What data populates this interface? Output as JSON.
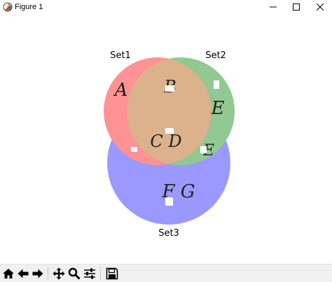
{
  "window": {
    "title": "Figure 1",
    "icons": {
      "app": "matplotlib-icon",
      "minimize": "minimize-icon",
      "maximize": "maximize-icon",
      "close": "close-icon"
    }
  },
  "venn": {
    "set_labels": [
      "Set1",
      "Set2",
      "Set3"
    ],
    "region_labels": {
      "set1_only": "A",
      "set1_set2": "B",
      "set2_only": "E",
      "center": "C D",
      "set2_set3": "E",
      "set3_only": "F G"
    },
    "colors": {
      "set1": "#ff8080",
      "set2": "#80c080",
      "set3": "#8080ff",
      "set1_set2": "#d8b890",
      "set1_set2_set3": "#c0a8c0",
      "set1_set3": "#e090e0",
      "set2_set3": "#90b0e0"
    }
  },
  "toolbar": {
    "buttons": [
      {
        "name": "home-button",
        "icon": "home-icon"
      },
      {
        "name": "back-button",
        "icon": "arrow-left-icon"
      },
      {
        "name": "forward-button",
        "icon": "arrow-right-icon"
      },
      {
        "name": "pan-button",
        "icon": "move-icon"
      },
      {
        "name": "zoom-button",
        "icon": "magnifier-icon"
      },
      {
        "name": "configure-subplots-button",
        "icon": "sliders-icon"
      },
      {
        "name": "save-button",
        "icon": "floppy-disk-icon"
      }
    ]
  }
}
